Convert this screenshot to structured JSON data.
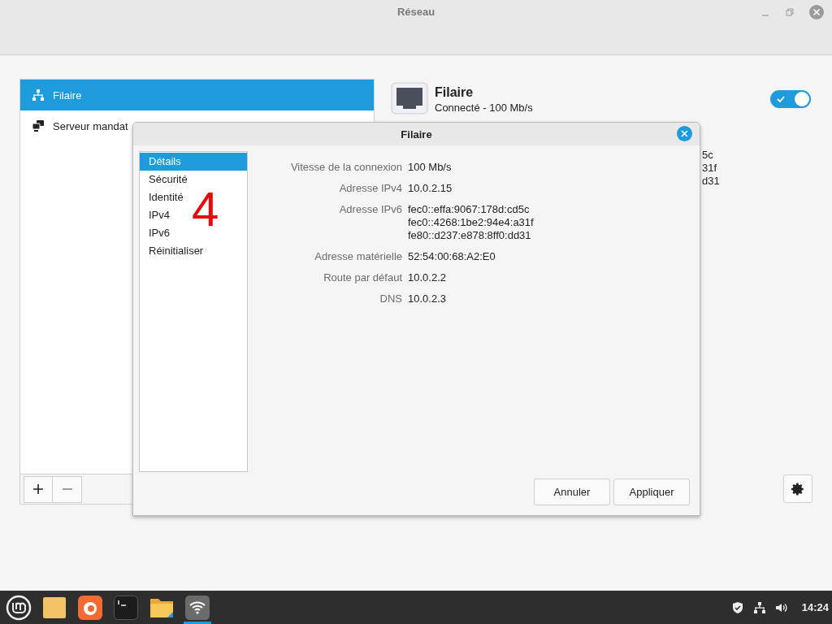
{
  "window": {
    "title": "Réseau"
  },
  "sidebar": {
    "items": [
      {
        "label": "Filaire",
        "kind": "wired",
        "selected": true
      },
      {
        "label": "Serveur mandat",
        "kind": "proxy",
        "selected": false
      }
    ]
  },
  "connection": {
    "title": "Filaire",
    "status": "Connecté - 100 Mb/s",
    "on": true,
    "details_fragments": [
      "5c",
      "31f",
      "d31"
    ]
  },
  "dialog": {
    "title": "Filaire",
    "tabs": [
      {
        "label": "Détails",
        "selected": true
      },
      {
        "label": "Sécurité",
        "selected": false
      },
      {
        "label": "Identité",
        "selected": false
      },
      {
        "label": "IPv4",
        "selected": false
      },
      {
        "label": "IPv6",
        "selected": false
      },
      {
        "label": "Réinitialiser",
        "selected": false
      }
    ],
    "details": [
      {
        "label": "Vitesse de la connexion",
        "values": [
          "100 Mb/s"
        ]
      },
      {
        "label": "Adresse IPv4",
        "values": [
          "10.0.2.15"
        ]
      },
      {
        "label": "Adresse IPv6",
        "values": [
          "fec0::effa:9067:178d:cd5c",
          "fec0::4268:1be2:94e4:a31f",
          "fe80::d237:e878:8ff0:dd31"
        ]
      },
      {
        "label": "Adresse matérielle",
        "values": [
          "52:54:00:68:A2:E0"
        ]
      },
      {
        "label": "Route par défaut",
        "values": [
          "10.0.2.2"
        ]
      },
      {
        "label": "DNS",
        "values": [
          "10.0.2.3"
        ]
      }
    ],
    "buttons": [
      "Annuler",
      "Appliquer"
    ]
  },
  "annotation": {
    "text": "4"
  },
  "taskbar": {
    "apps": [
      {
        "kind": "menu",
        "active": false
      },
      {
        "kind": "folder",
        "active": false
      },
      {
        "kind": "browser",
        "active": false
      },
      {
        "kind": "terminal",
        "active": false
      },
      {
        "kind": "files",
        "active": false
      },
      {
        "kind": "network",
        "active": true
      }
    ],
    "tray": [
      {
        "kind": "shield"
      },
      {
        "kind": "network"
      },
      {
        "kind": "volume"
      }
    ],
    "clock": "14:24"
  }
}
